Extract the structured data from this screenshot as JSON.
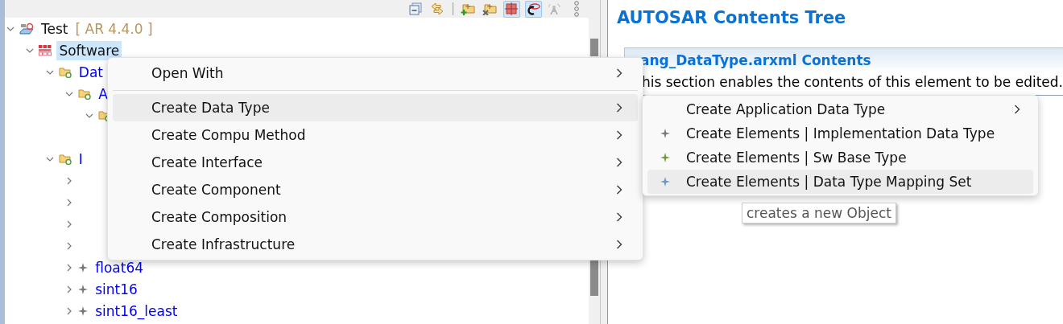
{
  "toolbar": {
    "tools": [
      {
        "kind": "collapse",
        "on": false
      },
      {
        "kind": "link",
        "on": false
      },
      {
        "kind": "folder-add",
        "on": false
      },
      {
        "kind": "folder-remove",
        "on": false
      },
      {
        "kind": "grid",
        "on": true
      },
      {
        "kind": "c-logo",
        "on": true
      },
      {
        "kind": "antenna",
        "on": false
      },
      {
        "kind": "more",
        "on": false
      }
    ]
  },
  "tree": [
    {
      "label": "Test",
      "version": "[ AR 4.4.0 ]",
      "kind": "project",
      "expanded": true,
      "selected": false,
      "children": [
        {
          "label": "Software",
          "kind": "root",
          "expanded": true,
          "selected": true,
          "children": [
            {
              "label": "Dat",
              "kind": "package",
              "expanded": true,
              "selected": false,
              "children": [
                {
                  "label": "A",
                  "kind": "package",
                  "expanded": true,
                  "children": [
                    {
                      "kind": "package",
                      "expanded": true
                    }
                  ]
                }
              ]
            },
            {
              "label": "I",
              "kind": "package",
              "expanded": true,
              "selected": false,
              "children": [
                {
                  "expanded": false
                },
                {
                  "expanded": false
                },
                {
                  "expanded": false
                },
                {
                  "expanded": false
                },
                {
                  "label": "float64",
                  "kind": "type",
                  "expanded": false,
                  "selected": false
                },
                {
                  "label": "sint16",
                  "kind": "type",
                  "expanded": false,
                  "selected": false
                },
                {
                  "label": "sint16_least",
                  "kind": "type",
                  "expanded": false,
                  "selected": false
                }
              ]
            }
          ]
        }
      ]
    }
  ],
  "editor": {
    "title": "AUTOSAR Contents Tree",
    "section": {
      "title": "ang_DataType.arxml Contents",
      "description": "his section enables the contents of this element to be edited."
    }
  },
  "context_menu": {
    "items": [
      {
        "kind": "item",
        "label": "Open With",
        "submenu": true,
        "selected": false
      },
      {
        "kind": "separator"
      },
      {
        "kind": "item",
        "label": "Create Data Type",
        "submenu": true,
        "selected": true
      },
      {
        "kind": "item",
        "label": "Create Compu Method",
        "submenu": true,
        "selected": false
      },
      {
        "kind": "item",
        "label": "Create Interface",
        "submenu": true,
        "selected": false
      },
      {
        "kind": "item",
        "label": "Create Component",
        "submenu": true,
        "selected": false
      },
      {
        "kind": "item",
        "label": "Create Composition",
        "submenu": true,
        "selected": false
      },
      {
        "kind": "item",
        "label": "Create Infrastructure",
        "submenu": true,
        "selected": false
      }
    ]
  },
  "submenu": {
    "items": [
      {
        "label": "Create Application Data Type",
        "submenu": true,
        "selected": false
      },
      {
        "label": "Create Elements | Implementation Data Type",
        "submenu": false,
        "selected": false,
        "color": "#7a7a7a"
      },
      {
        "label": "Create Elements | Sw Base Type",
        "submenu": false,
        "selected": false,
        "color": "#6f9a3a"
      },
      {
        "label": "Create Elements | Data Type Mapping Set",
        "submenu": false,
        "selected": true,
        "color": "#6a96c8"
      }
    ]
  },
  "tooltip": "creates a new Object"
}
